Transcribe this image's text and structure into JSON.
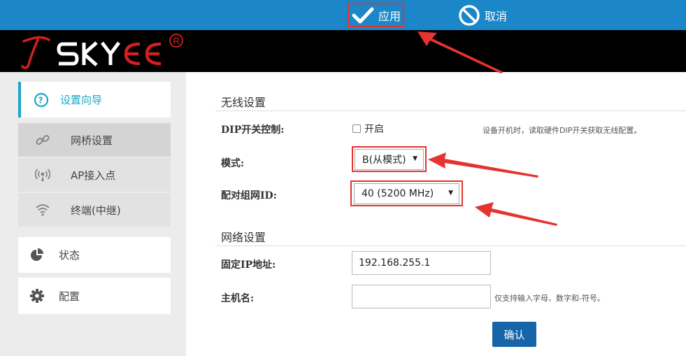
{
  "topbar": {
    "apply_label": "应用",
    "cancel_label": "取消"
  },
  "logo": {
    "text": "TSKYEE",
    "mark": "®"
  },
  "sidebar": {
    "items": [
      {
        "label": "设置向导",
        "icon": "help-circle-icon",
        "active": true
      },
      {
        "label": "网桥设置",
        "icon": "link-icon"
      },
      {
        "label": "AP接入点",
        "icon": "broadcast-icon"
      },
      {
        "label": "终端(中继)",
        "icon": "wifi-icon"
      },
      {
        "label": "状态",
        "icon": "pie-chart-icon"
      },
      {
        "label": "配置",
        "icon": "gear-icon"
      }
    ]
  },
  "wireless": {
    "section_title": "无线设置",
    "dip_label": "DIP开关控制:",
    "dip_checkbox_label": "开启",
    "dip_hint": "设备开机时，读取硬件DIP开关获取无线配置。",
    "mode_label": "模式:",
    "mode_value": "B(从模式)",
    "pair_label": "配对组网ID:",
    "pair_value": "40 (5200 MHz)"
  },
  "network": {
    "section_title": "网络设置",
    "ip_label": "固定IP地址:",
    "ip_value": "192.168.255.1",
    "host_label": "主机名:",
    "host_value": "",
    "host_hint": "仅支持输入字母、数字和-符号。",
    "confirm_label": "确认"
  },
  "colors": {
    "topbar": "#1b87c9",
    "accent_red": "#e5332f",
    "confirm_button": "#1565a8",
    "active_bar": "#1ba6c9"
  }
}
